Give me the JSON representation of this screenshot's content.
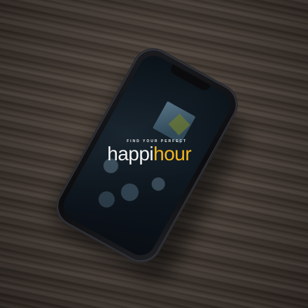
{
  "app": {
    "tagline": "FIND YOUR PERFECT",
    "logo_part1": "happi",
    "logo_part2": "hour"
  },
  "colors": {
    "logo_primary": "#f2f2f2",
    "logo_accent": "#f2b520",
    "desk_wood": "#4a3f36",
    "phone_body": "#111214"
  }
}
